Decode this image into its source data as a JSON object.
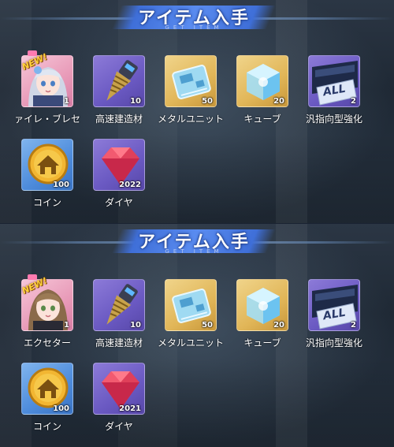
{
  "panels": [
    {
      "banner": {
        "title": "アイテム入手",
        "subtitle": "GET ITEM"
      },
      "items": [
        {
          "label": "ァイレ・ブレセ",
          "count": "1",
          "is_new": true,
          "new_text": "NEW!",
          "icon": "character-portrait-icon"
        },
        {
          "label": "高速建造材",
          "count": "10",
          "icon": "drill-icon"
        },
        {
          "label": "メタルユニット",
          "count": "50",
          "icon": "metal-unit-icon"
        },
        {
          "label": "キューブ",
          "count": "20",
          "icon": "cube-icon"
        },
        {
          "label": "汎指向型強化",
          "count": "2",
          "icon": "all-ticket-icon",
          "overlay_text": "ALL"
        },
        {
          "label": "コイン",
          "count": "100",
          "icon": "coin-icon"
        },
        {
          "label": "ダイヤ",
          "count": "2022",
          "icon": "diamond-icon"
        }
      ]
    },
    {
      "banner": {
        "title": "アイテム入手",
        "subtitle": "GET ITEM"
      },
      "items": [
        {
          "label": "エクセター",
          "count": "1",
          "is_new": true,
          "new_text": "NEW!",
          "icon": "character-portrait-icon"
        },
        {
          "label": "高速建造材",
          "count": "10",
          "icon": "drill-icon"
        },
        {
          "label": "メタルユニット",
          "count": "50",
          "icon": "metal-unit-icon"
        },
        {
          "label": "キューブ",
          "count": "20",
          "icon": "cube-icon"
        },
        {
          "label": "汎指向型強化",
          "count": "2",
          "icon": "all-ticket-icon",
          "overlay_text": "ALL"
        },
        {
          "label": "コイン",
          "count": "100",
          "icon": "coin-icon"
        },
        {
          "label": "ダイヤ",
          "count": "2021",
          "icon": "diamond-icon"
        }
      ]
    }
  ]
}
